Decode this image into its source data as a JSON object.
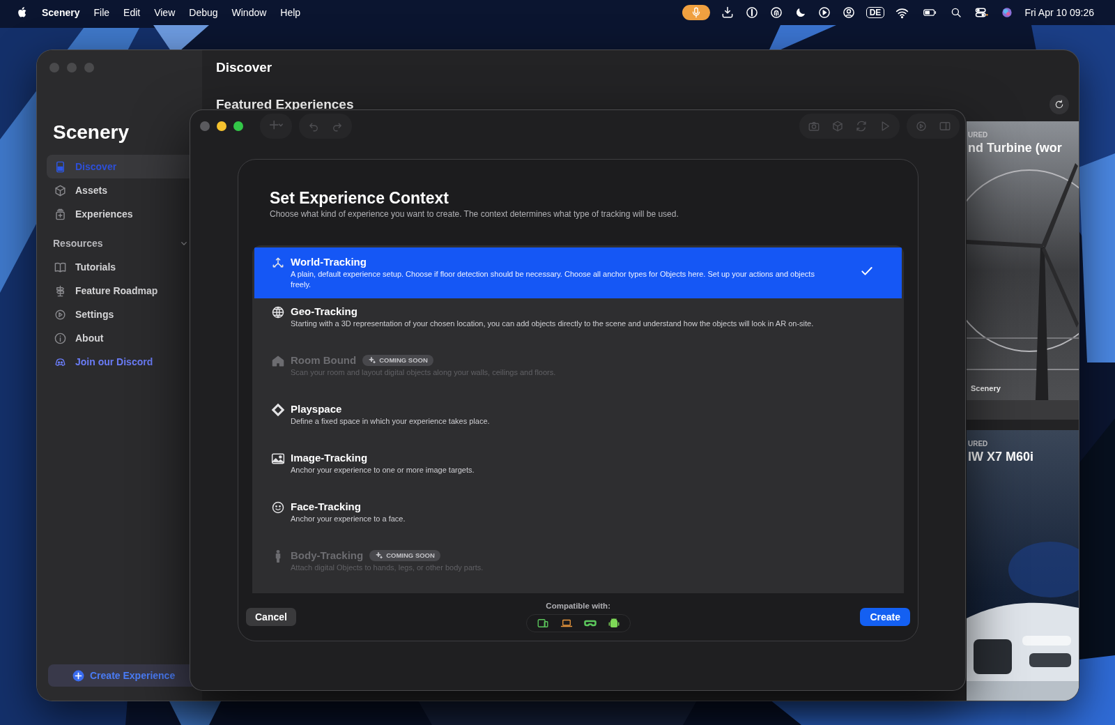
{
  "menu_bar": {
    "app_name": "Scenery",
    "menus": [
      "File",
      "Edit",
      "View",
      "Debug",
      "Window",
      "Help"
    ],
    "input_source": "DE",
    "clock": "Fri Apr 10  09:26"
  },
  "main_window": {
    "sidebar": {
      "title": "Scenery",
      "items": [
        {
          "label": "Discover",
          "selected": true
        },
        {
          "label": "Assets",
          "selected": false
        },
        {
          "label": "Experiences",
          "selected": false
        }
      ],
      "resources": {
        "title": "Resources",
        "expanded": true,
        "items": [
          {
            "label": "Tutorials",
            "kind": "page",
            "selected": false
          },
          {
            "label": "Feature Roadmap",
            "kind": "page",
            "selected": false
          },
          {
            "label": "Settings",
            "kind": "page",
            "selected": false
          },
          {
            "label": "About",
            "kind": "page",
            "selected": false
          },
          {
            "label": "Join our Discord",
            "kind": "link",
            "selected": false
          }
        ]
      },
      "create_button": "Create Experience"
    },
    "title": "Discover",
    "section_title": "Featured Experiences",
    "cards": [
      {
        "eyebrow": "URED",
        "title": "nd Turbine (wor",
        "author": "Scenery"
      },
      {
        "eyebrow": "URED",
        "title": "IW X7 M60i"
      }
    ]
  },
  "editor_window": {
    "sheet": {
      "title": "Set Experience Context",
      "subtitle": "Choose what kind of experience you want to create. The context determines what type of tracking will be used.",
      "options": [
        {
          "title": "World-Tracking",
          "description": "A plain, default experience setup. Choose if floor detection should be necessary. Choose all anchor types for Objects here. Set up your actions and objects freely.",
          "selected": true,
          "disabled": false
        },
        {
          "title": "Geo-Tracking",
          "description": "Starting with a 3D representation of your chosen location, you can add objects directly to the scene and understand how the objects will look in AR on-site.",
          "selected": false,
          "disabled": false
        },
        {
          "title": "Room Bound",
          "badge": "COMING SOON",
          "description": "Scan your room and layout digital objects along your walls, ceilings and floors.",
          "selected": false,
          "disabled": true
        },
        {
          "title": "Playspace",
          "description": "Define a fixed space in which your experience takes place.",
          "selected": false,
          "disabled": false
        },
        {
          "title": "Image-Tracking",
          "description": "Anchor your experience to one or more image targets.",
          "selected": false,
          "disabled": false
        },
        {
          "title": "Face-Tracking",
          "description": "Anchor your experience to a face.",
          "selected": false,
          "disabled": false
        },
        {
          "title": "Body-Tracking",
          "badge": "COMING SOON",
          "description": "Attach digital Objects to hands, legs, or other body parts.",
          "selected": false,
          "disabled": true
        }
      ],
      "compatible_label": "Compatible with:",
      "devices": [
        {
          "color": "#5cc85c"
        },
        {
          "color": "#e8963c"
        },
        {
          "color": "#5cc85c"
        },
        {
          "color": "#7ed957"
        }
      ],
      "cancel_button": "Cancel",
      "create_button": "Create"
    }
  }
}
